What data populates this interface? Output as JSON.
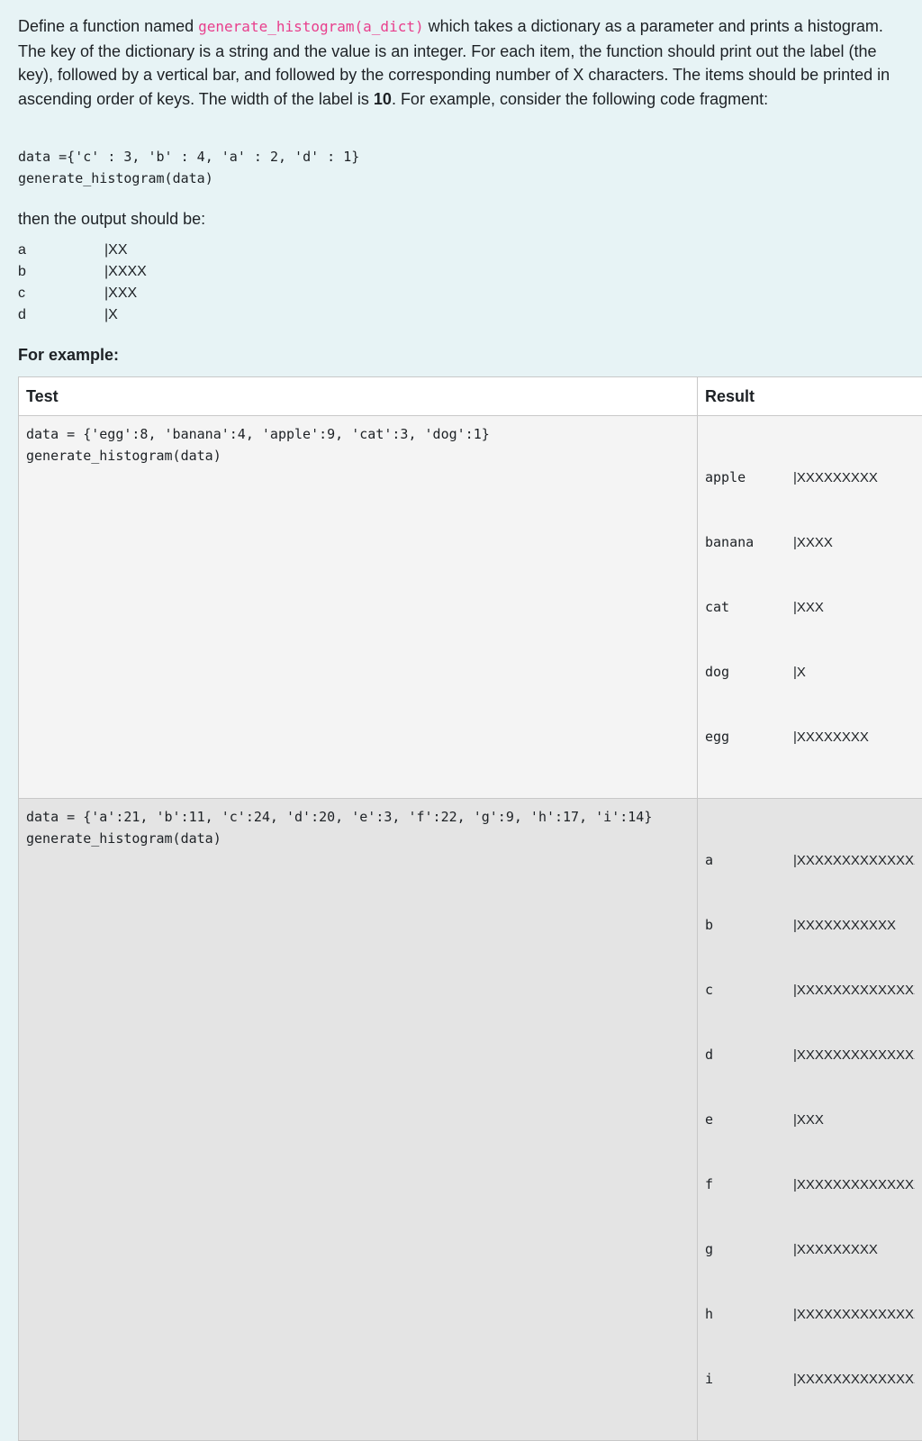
{
  "description": {
    "p1_before": "Define a function named ",
    "function_name": "generate_histogram(a_dict)",
    "p1_after": " which takes a dictionary as a parameter and prints a histogram. The key of the dictionary is a string and the value is an integer. For each item, the function should print out the label (the key), followed by a vertical bar, and followed by the corresponding number of X characters. The items should be printed in ascending order of keys. The width of the label is ",
    "label_width": "10",
    "p1_end": ". For example, consider the following code fragment:"
  },
  "code_sample": "data ={'c' : 3, 'b' : 4, 'a' : 2, 'd' : 1}\ngenerate_histogram(data)",
  "then_text": "then the output should be:",
  "sample_output": [
    {
      "label": "a",
      "bar": "|XX"
    },
    {
      "label": "b",
      "bar": "|XXXX"
    },
    {
      "label": "c",
      "bar": "|XXX"
    },
    {
      "label": "d",
      "bar": "|X"
    }
  ],
  "for_example": "For example:",
  "table": {
    "headers": {
      "test": "Test",
      "result": "Result"
    },
    "rows": [
      {
        "test": "data = {'egg':8, 'banana':4, 'apple':9, 'cat':3, 'dog':1}\ngenerate_histogram(data)",
        "result": [
          {
            "label": "apple",
            "bar": "|XXXXXXXXX"
          },
          {
            "label": "banana",
            "bar": "|XXXX"
          },
          {
            "label": "cat",
            "bar": "|XXX"
          },
          {
            "label": "dog",
            "bar": "|X"
          },
          {
            "label": "egg",
            "bar": "|XXXXXXXX"
          }
        ]
      },
      {
        "test": "data = {'a':21, 'b':11, 'c':24, 'd':20, 'e':3, 'f':22, 'g':9, 'h':17, 'i':14}\ngenerate_histogram(data)",
        "result": [
          {
            "label": "a",
            "bar": "|XXXXXXXXXXXXXXXXXXXXX"
          },
          {
            "label": "b",
            "bar": "|XXXXXXXXXXX"
          },
          {
            "label": "c",
            "bar": "|XXXXXXXXXXXXXXXXXXXXXXXX"
          },
          {
            "label": "d",
            "bar": "|XXXXXXXXXXXXXXXXXXXX"
          },
          {
            "label": "e",
            "bar": "|XXX"
          },
          {
            "label": "f",
            "bar": "|XXXXXXXXXXXXXXXXXXXXXX"
          },
          {
            "label": "g",
            "bar": "|XXXXXXXXX"
          },
          {
            "label": "h",
            "bar": "|XXXXXXXXXXXXXXXXX"
          },
          {
            "label": "i",
            "bar": "|XXXXXXXXXXXXXX"
          }
        ]
      }
    ]
  }
}
